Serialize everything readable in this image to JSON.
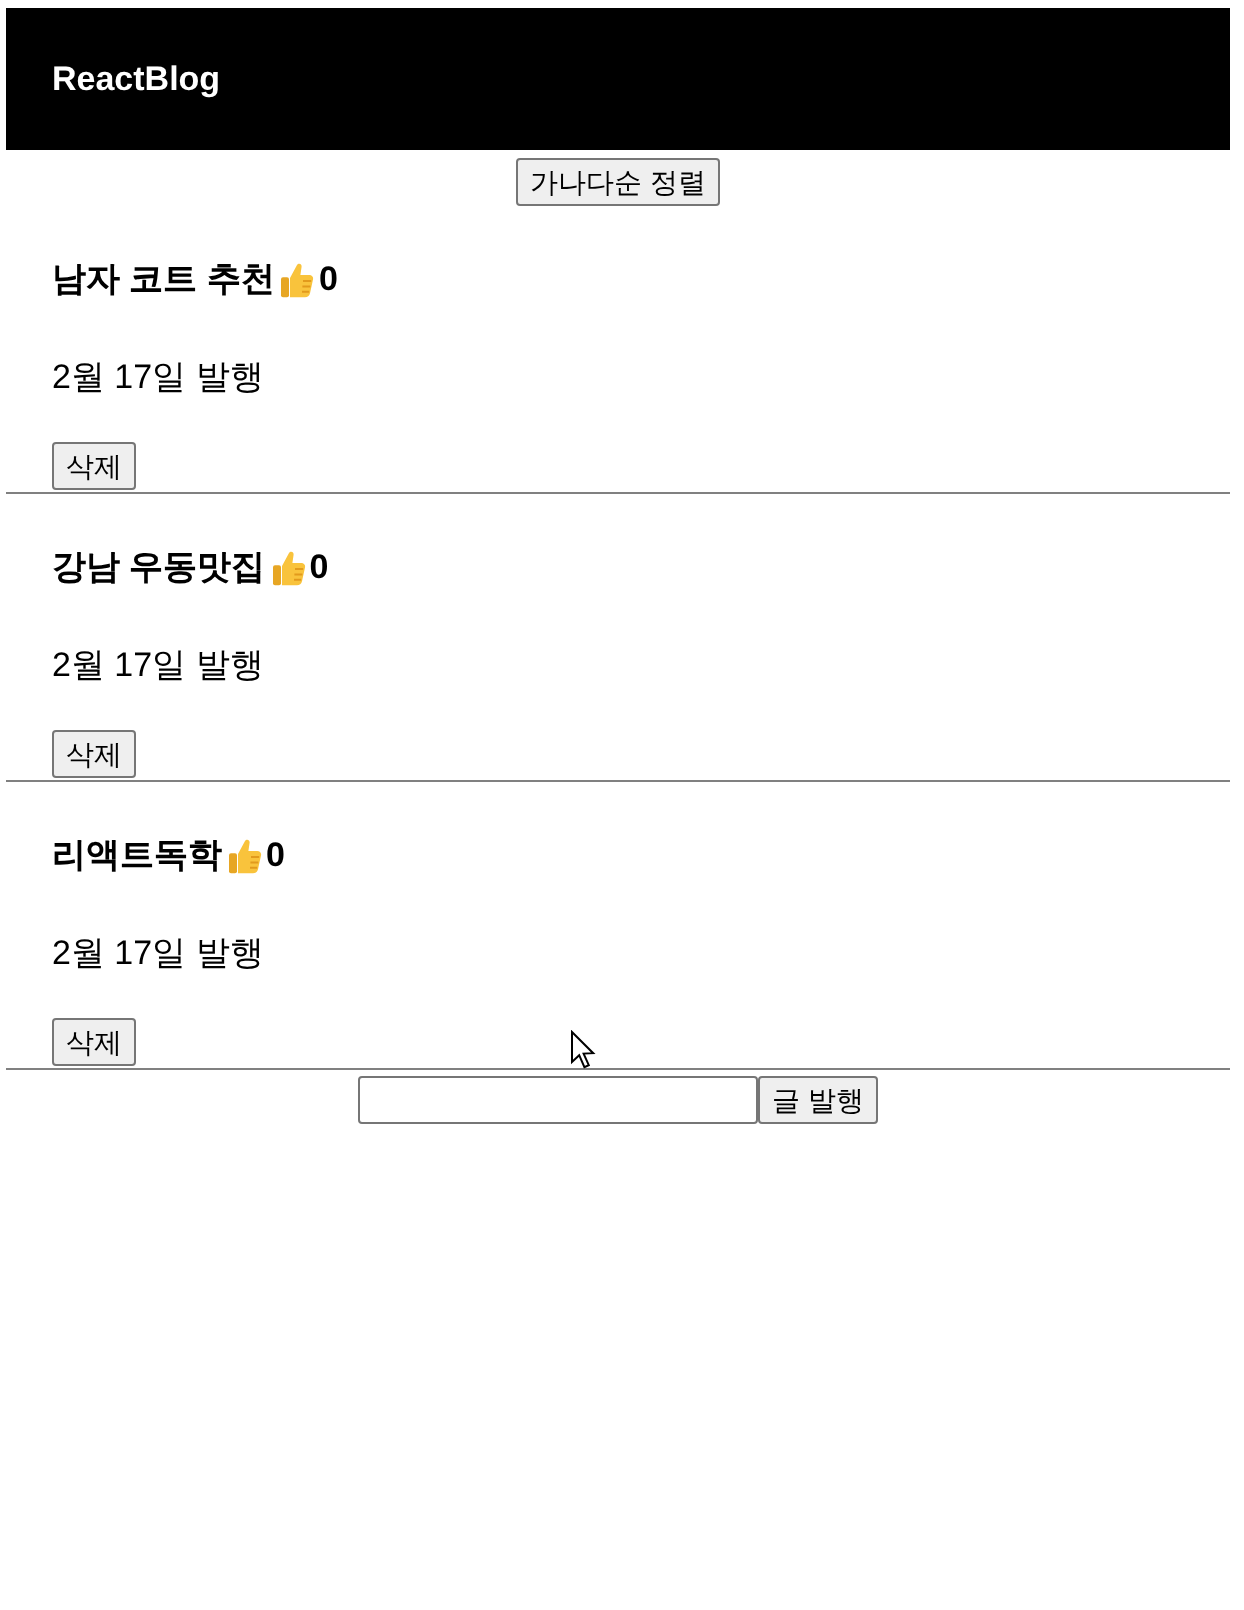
{
  "header": {
    "title": "ReactBlog"
  },
  "sort_button": {
    "label": "가나다순 정렬"
  },
  "posts": [
    {
      "title": "남자 코트 추천",
      "likes": "0",
      "date": "2월 17일 발행",
      "delete_label": "삭제"
    },
    {
      "title": "강남 우동맛집",
      "likes": "0",
      "date": "2월 17일 발행",
      "delete_label": "삭제"
    },
    {
      "title": "리액트독학",
      "likes": "0",
      "date": "2월 17일 발행",
      "delete_label": "삭제"
    }
  ],
  "composer": {
    "button": "글 발행"
  }
}
